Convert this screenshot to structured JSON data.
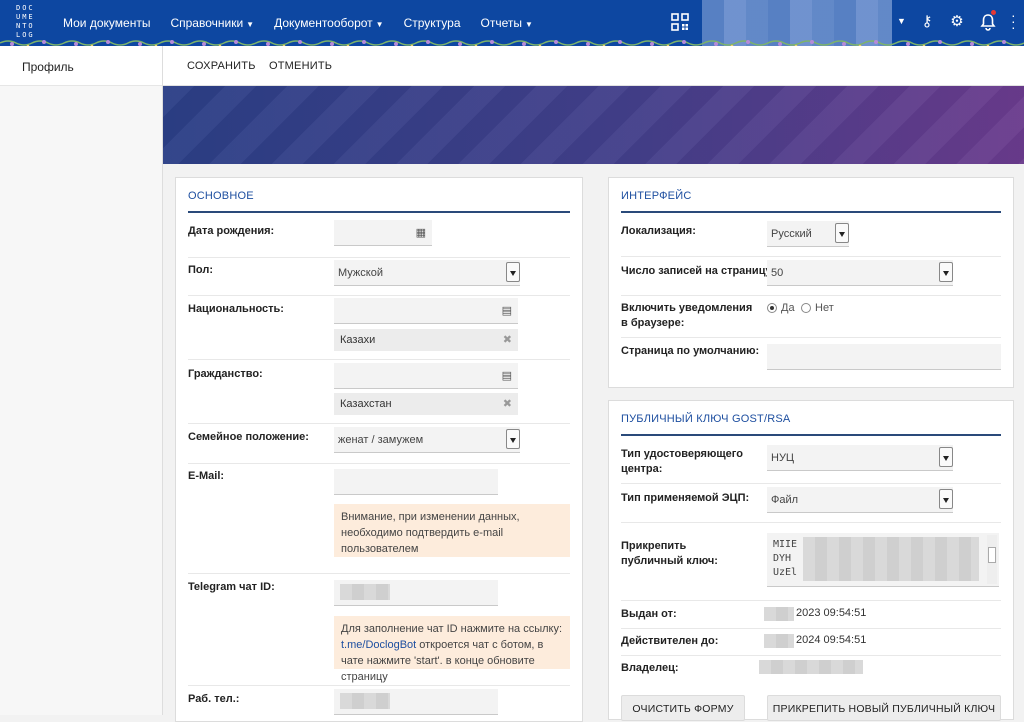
{
  "header": {
    "logo_letters": [
      "DOC",
      "UME",
      "NTO",
      "LOG"
    ],
    "nav": [
      {
        "label": "Мои документы",
        "dropdown": false
      },
      {
        "label": "Справочники",
        "dropdown": true
      },
      {
        "label": "Документооборот",
        "dropdown": true
      },
      {
        "label": "Структура",
        "dropdown": false
      },
      {
        "label": "Отчеты",
        "dropdown": true
      }
    ],
    "icons": [
      "qr-code-icon",
      "user-menu-caret",
      "key-icon",
      "settings-icon",
      "bell-icon",
      "more-icon"
    ]
  },
  "sidebar": {
    "items": [
      {
        "label": "Профиль"
      }
    ]
  },
  "toolbar": {
    "save_label": "СОХРАНИТЬ",
    "cancel_label": "ОТМЕНИТЬ"
  },
  "main_section": {
    "title": "ОСНОВНОЕ",
    "birth_date": {
      "label": "Дата рождения:",
      "value": ""
    },
    "gender": {
      "label": "Пол:",
      "value": "Мужской"
    },
    "nationality": {
      "label": "Национальность:",
      "value": "Казахи"
    },
    "citizenship": {
      "label": "Гражданство:",
      "value": "Казахстан"
    },
    "marital_status": {
      "label": "Семейное положение:",
      "value": "женат / замужем"
    },
    "email": {
      "label": "E-Mail:",
      "value": "",
      "warning": "Внимание, при изменении данных, необходимо подтвердить e-mail пользователем"
    },
    "telegram": {
      "label": "Telegram чат ID:",
      "hint_before": "Для заполнение чат ID нажмите на ссылку:",
      "hint_link": "t.me/DoclogBot",
      "hint_after": "откроется чат с ботом, в чате нажмите 'start'. в конце обновите страницу"
    },
    "work_phone": {
      "label": "Раб. тел.:"
    }
  },
  "interface_section": {
    "title": "ИНТЕРФЕЙС",
    "locale": {
      "label": "Локализация:",
      "value": "Русский"
    },
    "page_size": {
      "label": "Число записей на страницу:",
      "value": "50"
    },
    "notifications": {
      "label": "Включить уведомления в браузере:",
      "options": [
        "Да",
        "Нет"
      ],
      "selected": "Да"
    },
    "default_page": {
      "label": "Страница по умолчанию:",
      "value": ""
    }
  },
  "key_section": {
    "title": "ПУБЛИЧНЫЙ КЛЮЧ GOST/RSA",
    "ca_type": {
      "label": "Тип удостоверяющего центра:",
      "value": "НУЦ"
    },
    "eds_type": {
      "label": "Тип применяемой ЭЦП:",
      "value": "Файл"
    },
    "attach_key": {
      "label": "Прикрепить публичный ключ:",
      "lines": [
        "MIIE",
        "DYH",
        "UzEl"
      ]
    },
    "issued_from": {
      "label": "Выдан от:",
      "value": "2023 09:54:51"
    },
    "valid_until": {
      "label": "Действителен до:",
      "value": "2024 09:54:51"
    },
    "owner": {
      "label": "Владелец:"
    },
    "clear_button": "ОЧИСТИТЬ ФОРМУ",
    "attach_button": "ПРИКРЕПИТЬ НОВЫЙ ПУБЛИЧНЫЙ КЛЮЧ"
  }
}
